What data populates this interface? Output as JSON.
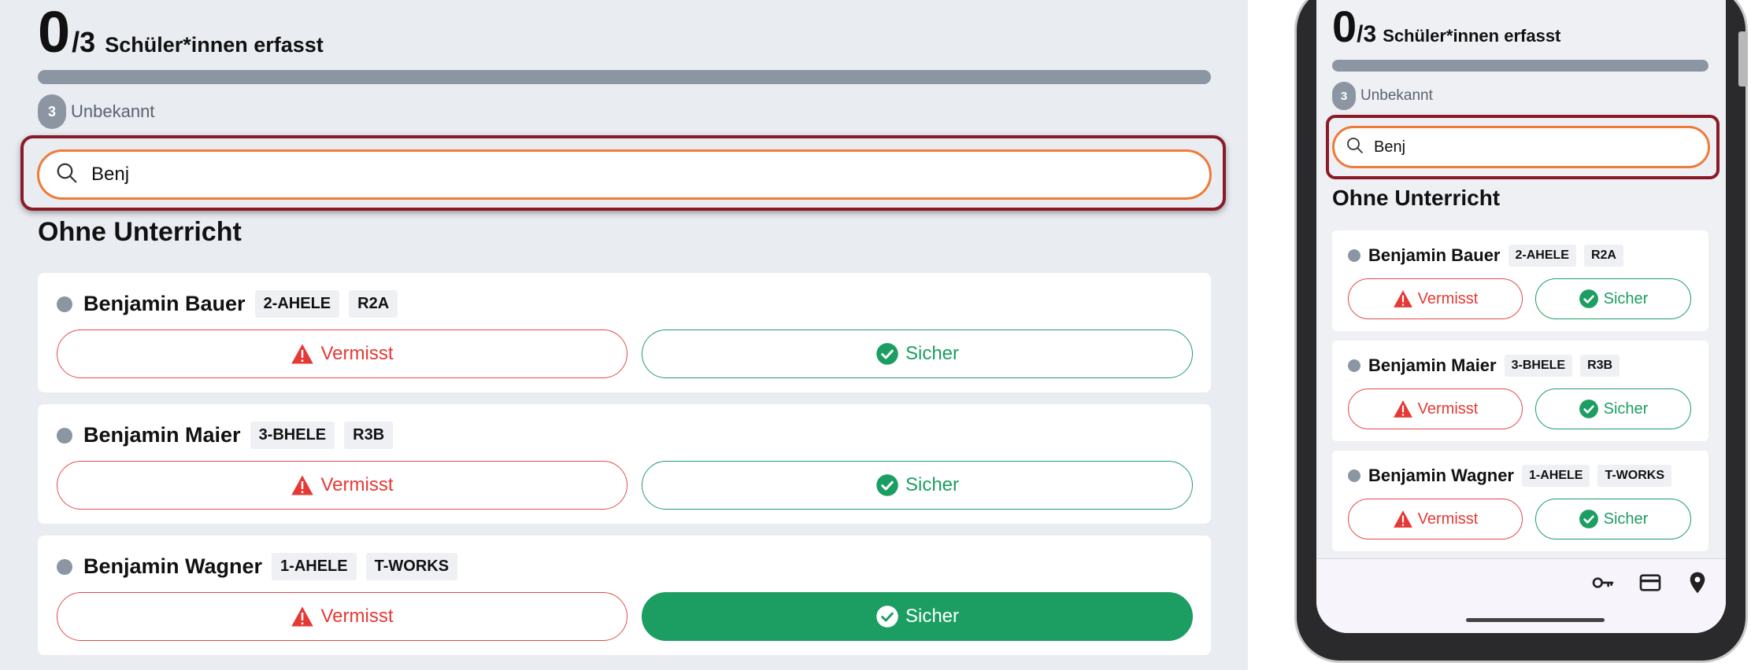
{
  "counter": {
    "value": "0",
    "total": "/3",
    "label": "Schüler*innen erfasst"
  },
  "progress": {
    "fraction": 0
  },
  "unknown": {
    "count": "3",
    "label": "Unbekannt"
  },
  "search": {
    "value": "Benj"
  },
  "section": {
    "title": "Ohne Unterricht"
  },
  "students": [
    {
      "name": "Benjamin Bauer",
      "tags": [
        "2-AHELE",
        "R2A"
      ],
      "missing_label": "Vermisst",
      "safe_label": "Sicher",
      "safe_selected": false
    },
    {
      "name": "Benjamin Maier",
      "tags": [
        "3-BHELE",
        "R3B"
      ],
      "missing_label": "Vermisst",
      "safe_label": "Sicher",
      "safe_selected": false
    },
    {
      "name": "Benjamin Wagner",
      "tags": [
        "1-AHELE",
        "T-WORKS"
      ],
      "missing_label": "Vermisst",
      "safe_label": "Sicher",
      "safe_selected": true
    }
  ],
  "mobile_nav": {
    "icons": [
      "key-icon",
      "card-icon",
      "location-pin-icon"
    ]
  },
  "colors": {
    "accent_orange": "#f07a38",
    "highlight_red": "#8b1a28",
    "danger": "#e53935",
    "success": "#1c9e63",
    "neutral": "#8c96a3"
  }
}
